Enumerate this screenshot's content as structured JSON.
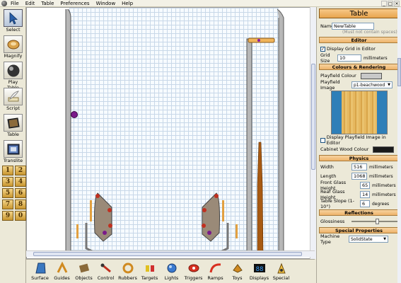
{
  "menu": [
    "File",
    "Edit",
    "Table",
    "Preferences",
    "Window",
    "Help"
  ],
  "window_controls": [
    "_",
    "□",
    "✕"
  ],
  "toolbox": [
    {
      "label": "Select",
      "icon": "cursor-icon"
    },
    {
      "label": "Magnify",
      "icon": "magnifier-icon"
    },
    {
      "label": "Play Table",
      "icon": "pinball-icon"
    },
    {
      "label": "Script",
      "icon": "quill-icon"
    },
    {
      "label": "Table",
      "icon": "table-icon"
    },
    {
      "label": "Translite",
      "icon": "translite-icon"
    }
  ],
  "number_buttons": [
    "1",
    "2",
    "3",
    "4",
    "5",
    "6",
    "7",
    "8",
    "9",
    "0"
  ],
  "bottom_tools": [
    {
      "label": "Surface",
      "icon": "surface-icon"
    },
    {
      "label": "Guides",
      "icon": "guides-icon"
    },
    {
      "label": "Objects",
      "icon": "objects-icon"
    },
    {
      "label": "Control",
      "icon": "control-icon"
    },
    {
      "label": "Rubbers",
      "icon": "rubbers-icon"
    },
    {
      "label": "Targets",
      "icon": "targets-icon"
    },
    {
      "label": "Lights",
      "icon": "lights-icon"
    },
    {
      "label": "Triggers",
      "icon": "triggers-icon"
    },
    {
      "label": "Ramps",
      "icon": "ramps-icon"
    },
    {
      "label": "Toys",
      "icon": "toys-icon"
    },
    {
      "label": "Displays",
      "icon": "displays-icon"
    },
    {
      "label": "Special",
      "icon": "special-icon"
    }
  ],
  "panel": {
    "title": "Table",
    "name_label": "Name",
    "name_value": "NewTable",
    "name_note": "(Must not contain spaces)",
    "editor_header": "Editor",
    "display_grid_label": "Display Grid in Editor",
    "display_grid_checked": true,
    "grid_size_label": "Grid Size",
    "grid_size_value": "10",
    "grid_size_unit": "millimeters",
    "colours_header": "Colours & Rendering",
    "playfield_colour_label": "Playfield Colour",
    "playfield_colour": "#c8c8c8",
    "playfield_image_label": "Playfield Image",
    "playfield_image_value": "p1-beachwood",
    "display_image_label": "Display Playfield Image in Editor",
    "display_image_checked": false,
    "cabinet_colour_label": "Cabinet Wood Colour",
    "cabinet_colour": "#1a1a1a",
    "physics_header": "Physics",
    "width_label": "Width",
    "width_value": "516",
    "length_label": "Length",
    "length_value": "1068",
    "front_glass_label": "Front Glass Height",
    "front_glass_value": "65",
    "rear_glass_label": "Rear Glass Height",
    "rear_glass_value": "145",
    "slope_label": "Table Slope (1-10°)",
    "slope_value": "6",
    "unit_mm": "millimeters",
    "unit_deg": "degrees",
    "reflections_header": "Reflections",
    "glossiness_label": "Glossiness",
    "glossiness_level": 0.55,
    "special_header": "Special Properties",
    "machine_type_label": "Machine Type",
    "machine_type_value": "SolidState"
  }
}
